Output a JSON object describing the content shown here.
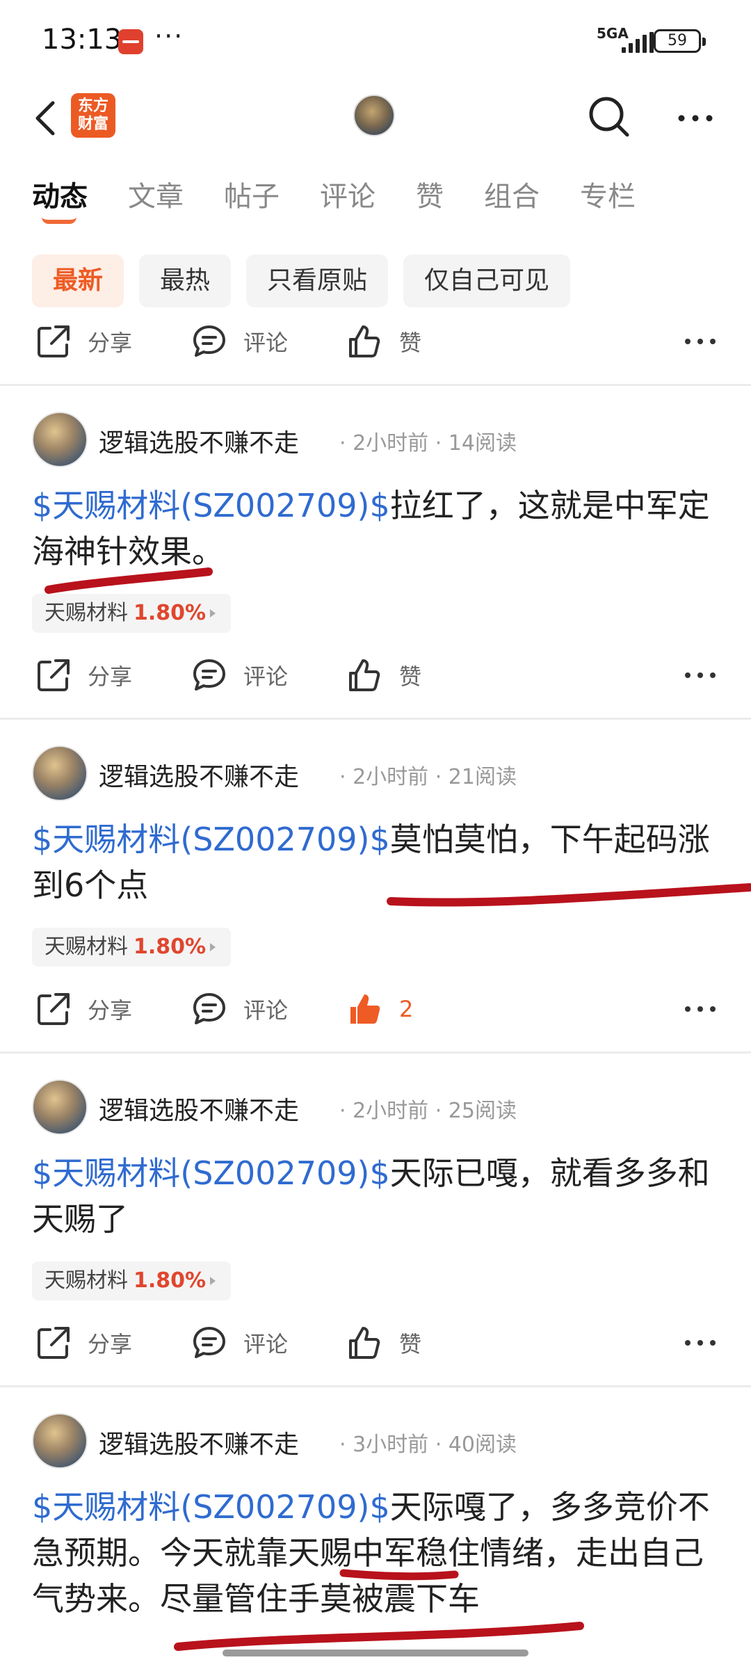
{
  "status_bar": {
    "time": "13:13",
    "dots": "···",
    "network": "5GA",
    "battery": "59"
  },
  "nav": {
    "brand_logo_text": "东方\n财富",
    "back_icon": "chevron-left-icon",
    "search_icon": "search-icon",
    "more_icon": "more-horizontal-icon"
  },
  "tabs": [
    "动态",
    "文章",
    "帖子",
    "评论",
    "赞",
    "组合",
    "专栏"
  ],
  "filters": [
    "最新",
    "最热",
    "只看原贴",
    "仅自己可见"
  ],
  "actions": {
    "share": "分享",
    "comment": "评论",
    "like": "赞"
  },
  "colors": {
    "accent": "#ee5b24",
    "link": "#2f6bd0",
    "rise": "#e0462e",
    "markup": "#b8121c"
  },
  "posts": [
    {
      "author": "逻辑选股不赚不走",
      "meta": "· 2小时前 · 14阅读",
      "stock_link": "$天赐材料(SZ002709)$",
      "text": "拉红了，这就是中军定海神针效果。",
      "tag_name": "天赐材料",
      "tag_pct": "1.80%",
      "like_label": "赞"
    },
    {
      "author": "逻辑选股不赚不走",
      "meta": "· 2小时前 · 21阅读",
      "stock_link": "$天赐材料(SZ002709)$",
      "text": "莫怕莫怕，下午起码涨到6个点",
      "tag_name": "天赐材料",
      "tag_pct": "1.80%",
      "like_label": "2"
    },
    {
      "author": "逻辑选股不赚不走",
      "meta": "· 2小时前 · 25阅读",
      "stock_link": "$天赐材料(SZ002709)$",
      "text": "天际已嘎，就看多多和天赐了",
      "tag_name": "天赐材料",
      "tag_pct": "1.80%",
      "like_label": "赞"
    },
    {
      "author": "逻辑选股不赚不走",
      "meta": "· 3小时前 · 40阅读",
      "stock_link": "$天赐材料(SZ002709)$",
      "text": "天际嘎了，多多竞价不急预期。今天就靠天赐中军稳住情绪，走出自己气势来。尽量管住手莫被震下车"
    }
  ]
}
